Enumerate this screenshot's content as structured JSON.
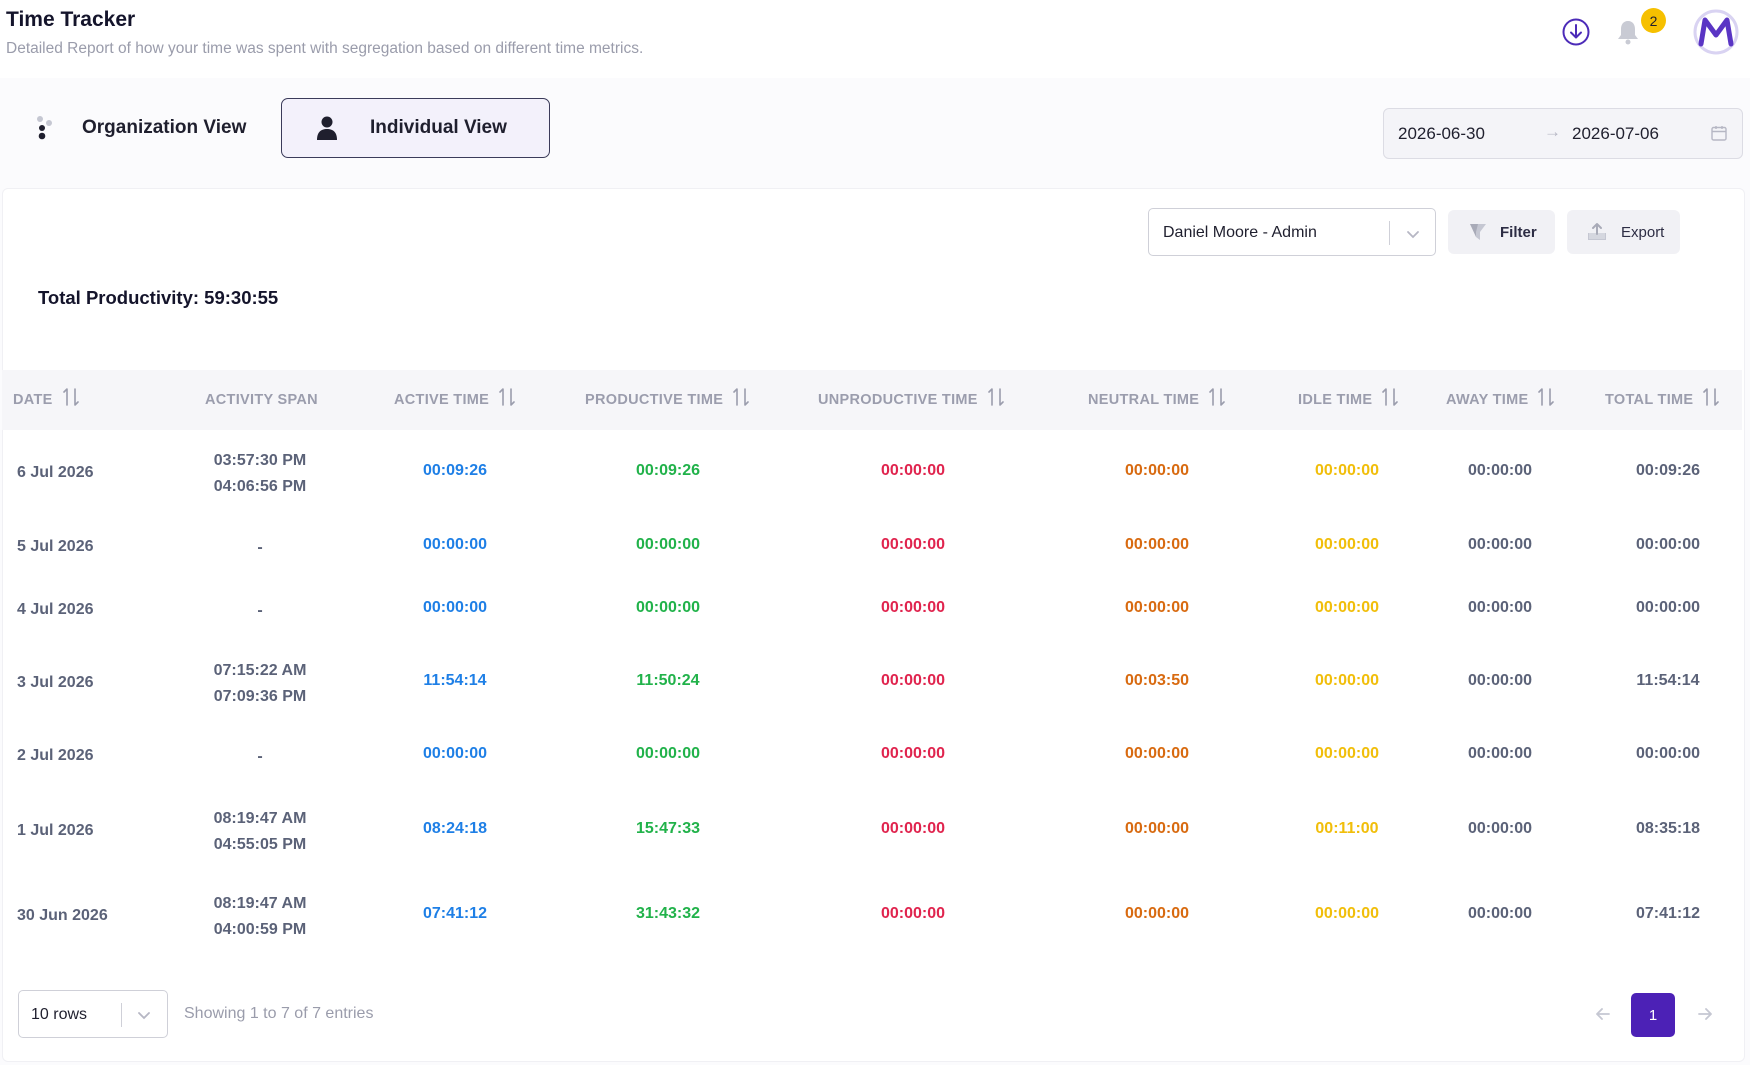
{
  "header": {
    "title": "Time Tracker",
    "subtitle": "Detailed Report of how your time was spent with segregation based on different time metrics.",
    "notification_count": "2"
  },
  "view_toggle": {
    "organization_label": "Organization View",
    "individual_label": "Individual View",
    "active": "individual"
  },
  "date_range": {
    "start": "2026-06-30",
    "end": "2026-07-06",
    "separator": "→"
  },
  "toolbar": {
    "user_select_value": "Daniel Moore - Admin",
    "filter_label": "Filter",
    "export_label": "Export"
  },
  "summary": {
    "total_productivity_label": "Total Productivity: 59:30:55"
  },
  "table": {
    "columns": [
      "DATE",
      "ACTIVITY SPAN",
      "ACTIVE TIME",
      "PRODUCTIVE TIME",
      "UNPRODUCTIVE TIME",
      "NEUTRAL TIME",
      "IDLE TIME",
      "AWAY TIME",
      "TOTAL TIME"
    ],
    "rows": [
      {
        "date": "6 Jul 2026",
        "span_start": "03:57:30 PM",
        "span_end": "04:06:56 PM",
        "active": "00:09:26",
        "productive": "00:09:26",
        "unproductive": "00:00:00",
        "neutral": "00:00:00",
        "idle": "00:00:00",
        "away": "00:00:00",
        "total": "00:09:26"
      },
      {
        "date": "5 Jul 2026",
        "span_start": "-",
        "span_end": "",
        "active": "00:00:00",
        "productive": "00:00:00",
        "unproductive": "00:00:00",
        "neutral": "00:00:00",
        "idle": "00:00:00",
        "away": "00:00:00",
        "total": "00:00:00"
      },
      {
        "date": "4 Jul 2026",
        "span_start": "-",
        "span_end": "",
        "active": "00:00:00",
        "productive": "00:00:00",
        "unproductive": "00:00:00",
        "neutral": "00:00:00",
        "idle": "00:00:00",
        "away": "00:00:00",
        "total": "00:00:00"
      },
      {
        "date": "3 Jul 2026",
        "span_start": "07:15:22 AM",
        "span_end": "07:09:36 PM",
        "active": "11:54:14",
        "productive": "11:50:24",
        "unproductive": "00:00:00",
        "neutral": "00:03:50",
        "idle": "00:00:00",
        "away": "00:00:00",
        "total": "11:54:14"
      },
      {
        "date": "2 Jul 2026",
        "span_start": "-",
        "span_end": "",
        "active": "00:00:00",
        "productive": "00:00:00",
        "unproductive": "00:00:00",
        "neutral": "00:00:00",
        "idle": "00:00:00",
        "away": "00:00:00",
        "total": "00:00:00"
      },
      {
        "date": "1 Jul 2026",
        "span_start": "08:19:47 AM",
        "span_end": "04:55:05 PM",
        "active": "08:24:18",
        "productive": "15:47:33",
        "unproductive": "00:00:00",
        "neutral": "00:00:00",
        "idle": "00:11:00",
        "away": "00:00:00",
        "total": "08:35:18"
      },
      {
        "date": "30 Jun 2026",
        "span_start": "08:19:47 AM",
        "span_end": "04:00:59 PM",
        "active": "07:41:12",
        "productive": "31:43:32",
        "unproductive": "00:00:00",
        "neutral": "00:00:00",
        "idle": "00:00:00",
        "away": "00:00:00",
        "total": "07:41:12"
      }
    ]
  },
  "footer": {
    "rows_per_page": "10 rows",
    "entries_info": "Showing 1 to 7 of 7 entries",
    "current_page": "1"
  },
  "icons": {
    "download": "download-circle-icon",
    "bell": "bell-icon",
    "logo": "brand-m-logo",
    "organization": "organization-icon",
    "individual": "person-icon",
    "calendar": "calendar-icon",
    "filter": "filter-icon",
    "export": "export-upload-icon",
    "sort": "sort-arrows-icon",
    "chevron": "chevron-down-icon",
    "prev": "arrow-left-icon",
    "next": "arrow-right-icon"
  },
  "colors": {
    "accent": "#4c21b6",
    "active_time": "#1e7fe6",
    "productive_time": "#21b24a",
    "unproductive_time": "#e0244e",
    "neutral_time": "#d86a10",
    "idle_time": "#f1be0a",
    "muted_text": "#5b6278",
    "badge": "#f6c000"
  }
}
